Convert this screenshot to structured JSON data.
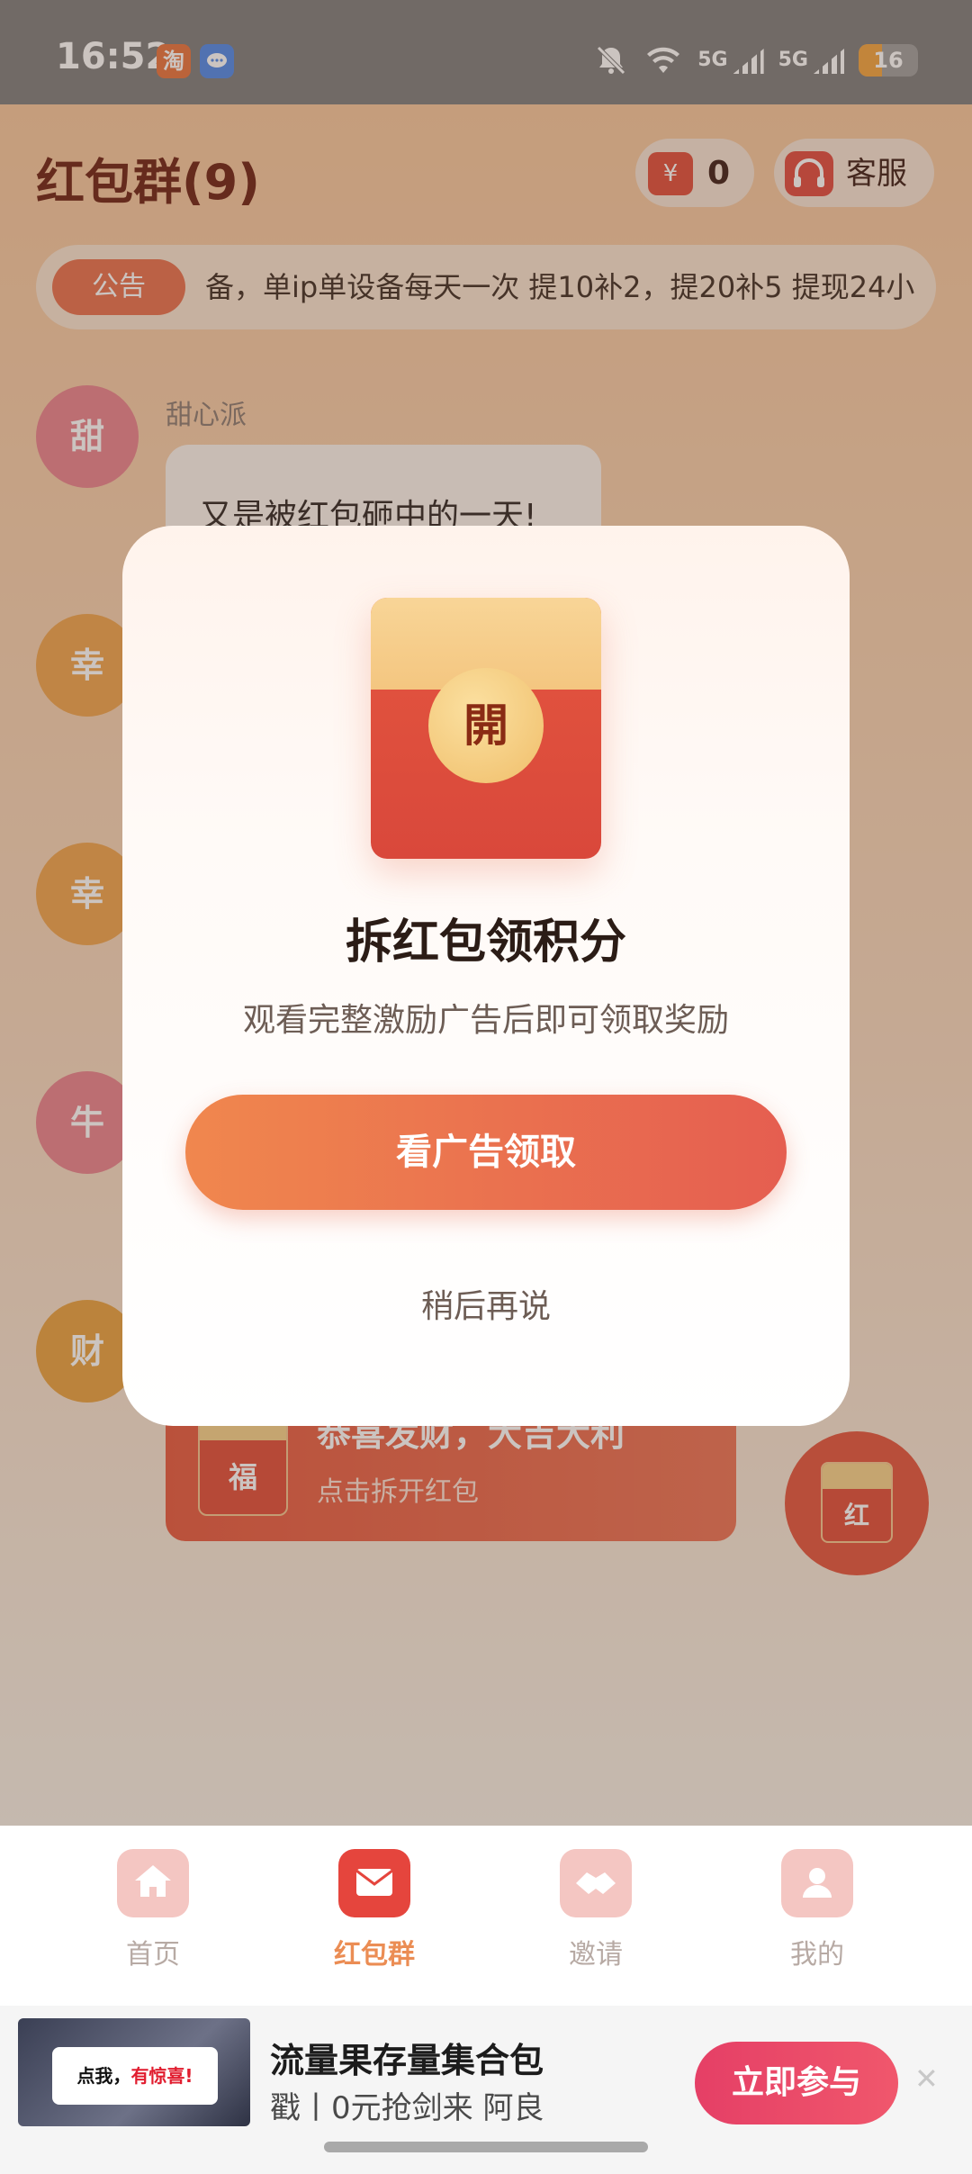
{
  "status_bar": {
    "time": "16:52",
    "taobao_icon": "淘",
    "message_icon": "💬",
    "mute_icon": "🔕",
    "wifi_icon": "wifi-icon",
    "signal1": "5G",
    "signal2": "5G",
    "battery": "16"
  },
  "header": {
    "title": "红包群(9)",
    "yen_symbol": "¥",
    "balance": "0",
    "service_label": "客服",
    "headphones_icon": "🎧"
  },
  "notice": {
    "tag": "公告",
    "text": "备，单ip单设备每天一次 提10补2，提20补5 提现24小"
  },
  "chat": {
    "avatars": [
      "甜",
      "幸",
      "幸",
      "牛",
      "财"
    ],
    "sender_name": "甜心派",
    "message": "又是被红包砸中的一天!",
    "red_packet": {
      "badge": "福",
      "title": "恭喜发财，大吉大利",
      "subtitle": "点击拆开红包"
    },
    "float_badge": "红"
  },
  "modal": {
    "seal": "開",
    "title": "拆红包领积分",
    "description": "观看完整激励广告后即可领取奖励",
    "primary_button": "看广告领取",
    "secondary_button": "稍后再说"
  },
  "tabbar": {
    "items": [
      {
        "label": "首页",
        "icon": "home-icon",
        "glyph": "⌂"
      },
      {
        "label": "红包群",
        "icon": "envelope-icon",
        "glyph": "✉"
      },
      {
        "label": "邀请",
        "icon": "handshake-icon",
        "glyph": "✋"
      },
      {
        "label": "我的",
        "icon": "person-icon",
        "glyph": "☺"
      }
    ],
    "active_index": 1
  },
  "ad": {
    "thumb_text": "点我，",
    "thumb_text_red": "有惊喜!",
    "title": "流量果存量集合包",
    "subtitle": "戳丨0元抢剑来 阿良",
    "button": "立即参与",
    "close": "✕"
  },
  "colors": {
    "accent": "#e5453d",
    "button_gradient_start": "#f0874e",
    "button_gradient_end": "#e55e50",
    "ad_button": "#e53f66"
  }
}
